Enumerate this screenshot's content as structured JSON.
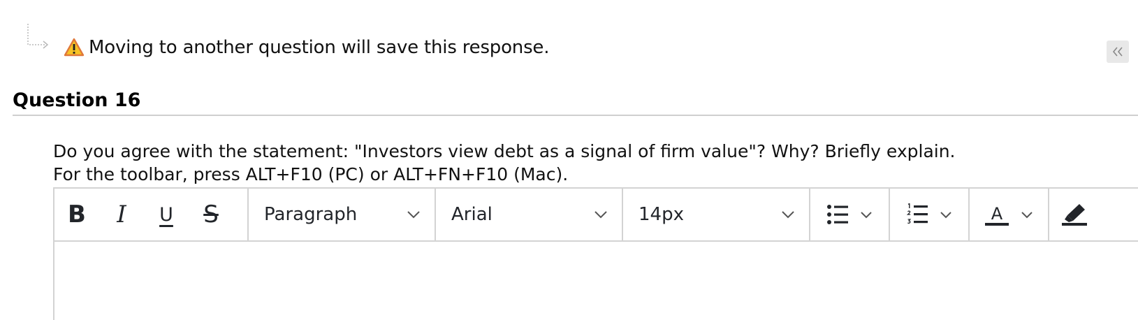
{
  "notice": {
    "text": "Moving to another question will save this response."
  },
  "question": {
    "title": "Question 16",
    "prompt": "Do you agree with the statement: \"Investors view debt as a signal of firm value\"? Why? Briefly explain.",
    "toolbar_hint": "For the toolbar, press ALT+F10 (PC) or ALT+FN+F10 (Mac)."
  },
  "editor": {
    "format_buttons": {
      "bold": "B",
      "italic": "I",
      "underline": "U",
      "strikethrough": "S"
    },
    "paragraph_select": "Paragraph",
    "font_select": "Arial",
    "size_select": "14px",
    "text_color_glyph": "A",
    "content": ""
  },
  "icons": [
    "warning-icon",
    "double-chevron-left-icon",
    "chevron-down-icon",
    "bullet-list-icon",
    "numbered-list-icon",
    "text-color-icon",
    "highlight-marker-icon"
  ],
  "colors": {
    "warning_fill": "#f7c325",
    "warning_stroke": "#e0783a",
    "icon_dark": "#22252a",
    "border": "#d3d3d3"
  }
}
